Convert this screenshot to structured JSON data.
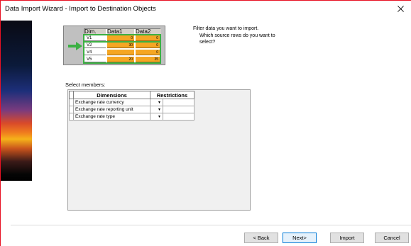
{
  "window": {
    "title": "Data Import Wizard - Import to Destination Objects"
  },
  "preview": {
    "headers": [
      "Dim.",
      "Data1",
      "Data2"
    ],
    "rows": [
      {
        "dim": "V1",
        "data1": "0",
        "data2": "0"
      },
      {
        "dim": "V2",
        "data1": "30",
        "data2": "0"
      },
      {
        "dim": "V4",
        "data1": "",
        "data2": "0"
      },
      {
        "dim": "V5",
        "data1": "20",
        "data2": "35"
      }
    ]
  },
  "filter": {
    "heading": "Filter data you want to import.",
    "question": "Which source rows do you want to select?"
  },
  "members": {
    "label": "Select members:",
    "columns": [
      "Dimensions",
      "Restrictions"
    ],
    "rows": [
      {
        "dimension": "Exchange rate currency",
        "restriction": ""
      },
      {
        "dimension": "Exchange rate reporting unit",
        "restriction": ""
      },
      {
        "dimension": "Exchange rate type",
        "restriction": ""
      }
    ],
    "dropdown_glyph": "▾"
  },
  "buttons": {
    "back": "< Back",
    "next": "Next>",
    "import": "Import",
    "cancel": "Cancel"
  },
  "colors": {
    "accent": "#0078d7",
    "highlight_cells": "#f5a623",
    "selection_frame": "#3cb043",
    "window_border": "#e81123"
  },
  "icons": {
    "close": "close-icon",
    "arrow": "arrow-right-icon"
  }
}
